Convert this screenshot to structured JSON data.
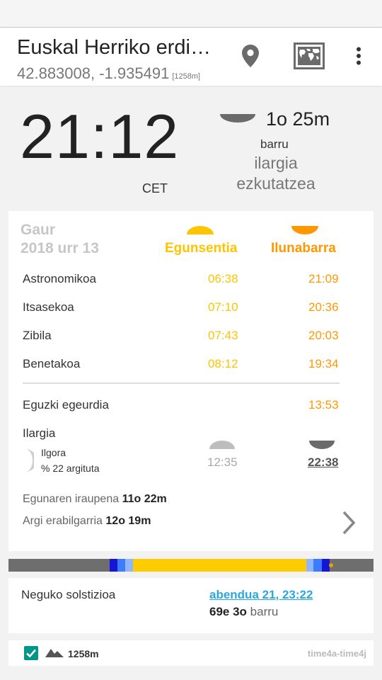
{
  "header": {
    "location_name": "Euskal Herriko erdi…",
    "coordinates": "42.883008, -1.935491",
    "altitude_tag": "[1258m]"
  },
  "clock": {
    "time": "21:12",
    "timezone": "CET"
  },
  "moon_event": {
    "duration": "1o 25m",
    "in_label": "barru",
    "event_line1": "ilargia",
    "event_line2": "ezkutatzea"
  },
  "day_table": {
    "today_label": "Gaur",
    "date": "2018 urr 13",
    "sunrise_header": "Egunsentia",
    "sunset_header": "Ilunabarra",
    "twilight_rows": [
      {
        "label": "Astronomikoa",
        "rise": "06:38",
        "set": "21:09"
      },
      {
        "label": "Itsasekoa",
        "rise": "07:10",
        "set": "20:36"
      },
      {
        "label": "Zibila",
        "rise": "07:43",
        "set": "20:03"
      },
      {
        "label": "Benetakoa",
        "rise": "08:12",
        "set": "19:34"
      }
    ],
    "noon_label": "Eguzki egeurdia",
    "noon_time": "13:53",
    "moon_label": "Ilargia",
    "moon_phase_name": "Ilgora",
    "moon_phase_pct": "% 22 argituta",
    "moonrise": "12:35",
    "moonset": "22:38",
    "day_length_label": "Egunaren iraupena",
    "day_length_value": "11o 22m",
    "usable_light_label": "Argi erabilgarria",
    "usable_light_value": "12o 19m"
  },
  "day_bar": {
    "colors": {
      "night": "#6e6e6e",
      "astro": "#1515d8",
      "nautical": "#3d7bff",
      "civil": "#8fb6ff",
      "day": "#ffcc00",
      "now_dot": "#e0a000"
    }
  },
  "solstice": {
    "label": "Neguko solstizioa",
    "date": "abendua 21, 23:22",
    "in_value": "69e 3o",
    "in_label": "barru"
  },
  "footer": {
    "altitude": "1258m",
    "version": "time4a-time4j",
    "checkbox_checked": true
  },
  "colors": {
    "sunrise": "#ffc400",
    "sunset": "#ff9800",
    "link": "#29a8e0",
    "accent": "#009688"
  }
}
